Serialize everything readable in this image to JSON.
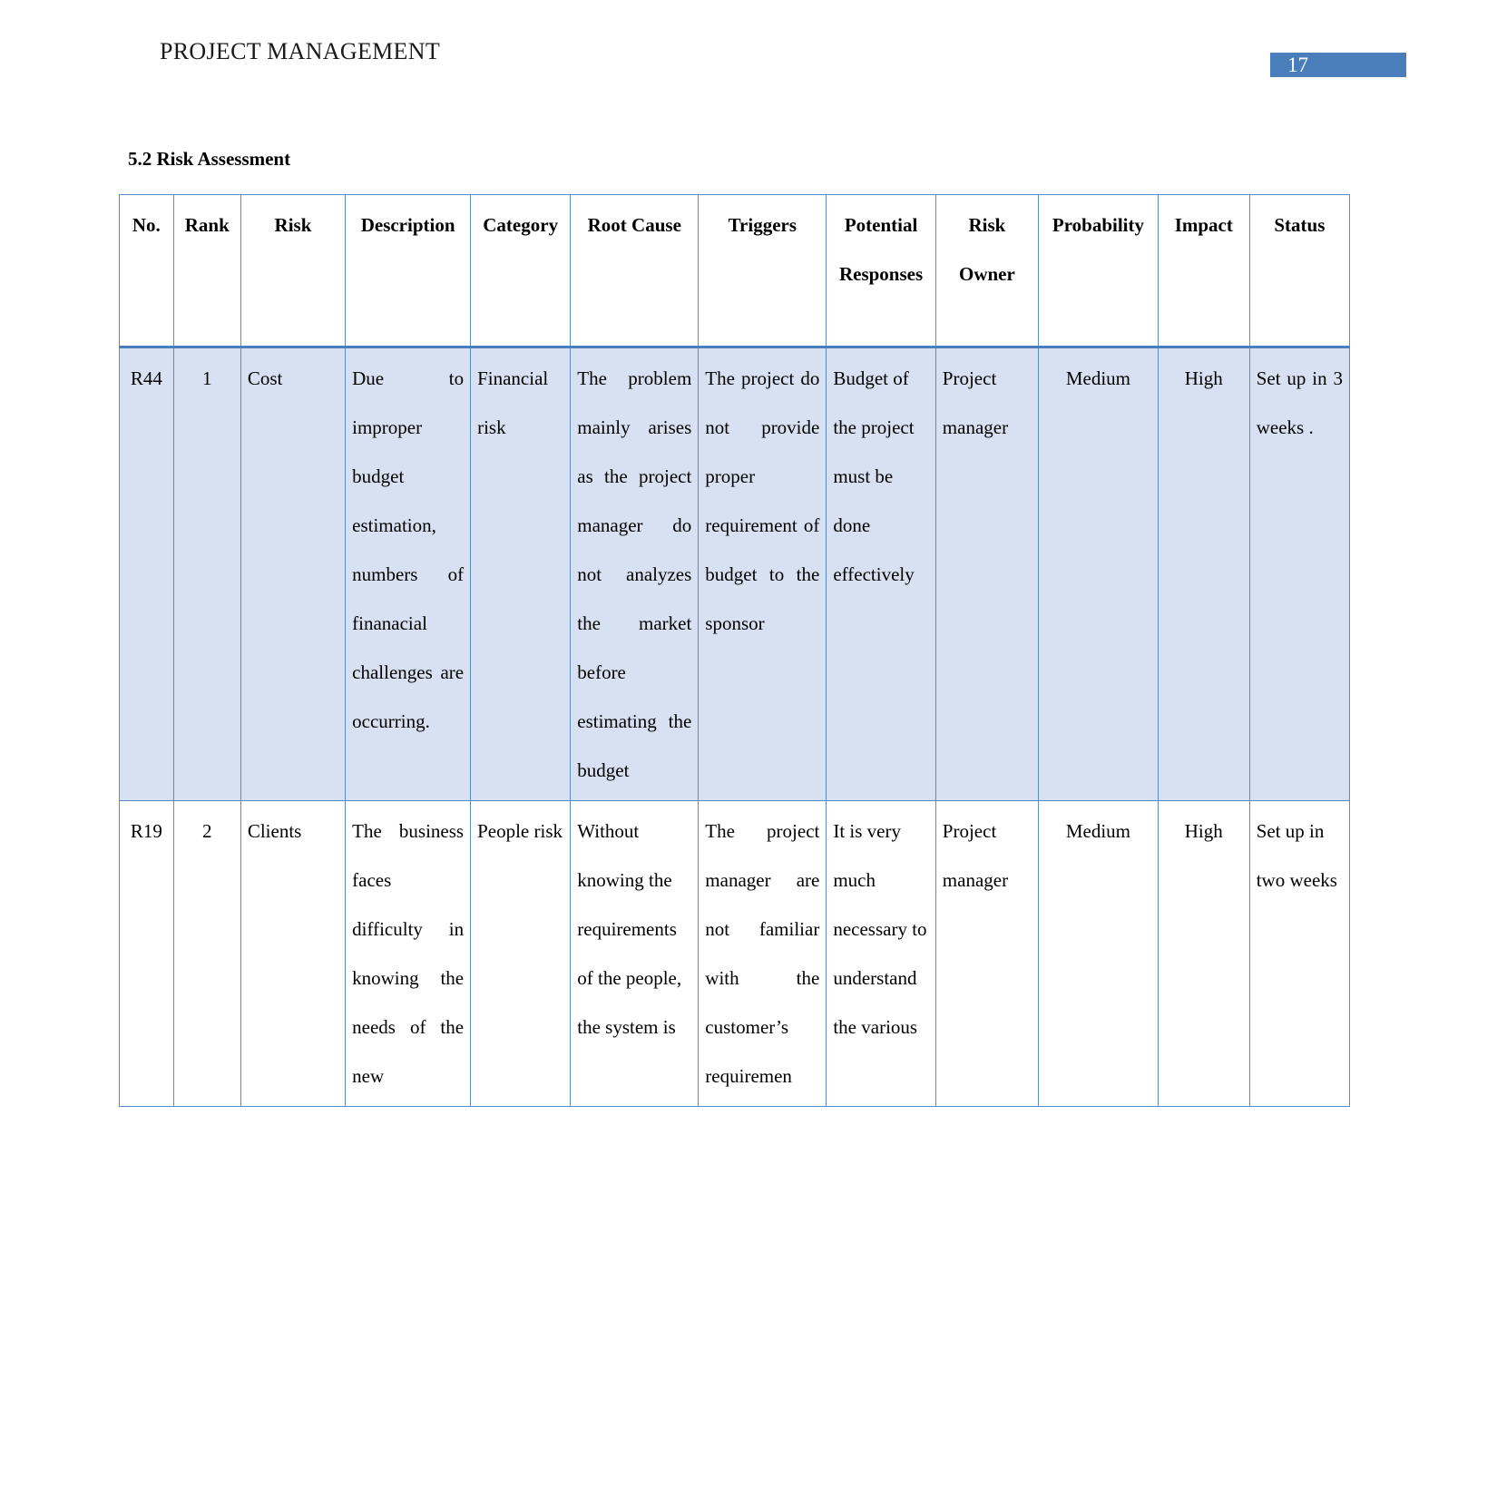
{
  "header": {
    "running_title": "PROJECT MANAGEMENT",
    "page_number": "17",
    "badge_color": "#4a7ebb"
  },
  "section": {
    "heading": "5.2 Risk Assessment"
  },
  "table": {
    "columns": [
      {
        "key": "no",
        "label": "No."
      },
      {
        "key": "rank",
        "label": "Rank"
      },
      {
        "key": "risk",
        "label": "Risk"
      },
      {
        "key": "desc",
        "label": "Description"
      },
      {
        "key": "cat",
        "label": "Category"
      },
      {
        "key": "root",
        "label": "Root Cause"
      },
      {
        "key": "trig",
        "label": "Triggers"
      },
      {
        "key": "resp",
        "label": "Potential Responses"
      },
      {
        "key": "owner",
        "label": "Risk Owner"
      },
      {
        "key": "prob",
        "label": "Probability"
      },
      {
        "key": "impact",
        "label": "Impact"
      },
      {
        "key": "status",
        "label": "Status"
      }
    ],
    "rows": [
      {
        "shaded": true,
        "no": "R44",
        "rank": "1",
        "risk": "Cost",
        "desc": "Due to improper budget estimation, numbers of finanacial challenges are occurring.",
        "cat": "Financial risk",
        "root": "The problem mainly arises as the project manager do not analyzes the market before estimating the budget",
        "trig": "The project do not provide proper requirement of budget to the sponsor",
        "resp": "Budget of the project must be done effectively",
        "owner": "Project manager",
        "prob": "Medium",
        "impact": "High",
        "status": "Set up in 3 weeks ."
      },
      {
        "shaded": false,
        "no": "R19",
        "rank": "2",
        "risk": "Clients",
        "desc": "The business faces difficulty in knowing the needs of the new",
        "cat": "People risk",
        "root": "Without knowing the requirements of the people, the system is",
        "trig": "The project manager are not familiar with the customer’s requiremen",
        "resp": "It is very much necessary to understand the various",
        "owner": "Project manager",
        "prob": "Medium",
        "impact": "High",
        "status": "Set up in two weeks"
      }
    ]
  }
}
